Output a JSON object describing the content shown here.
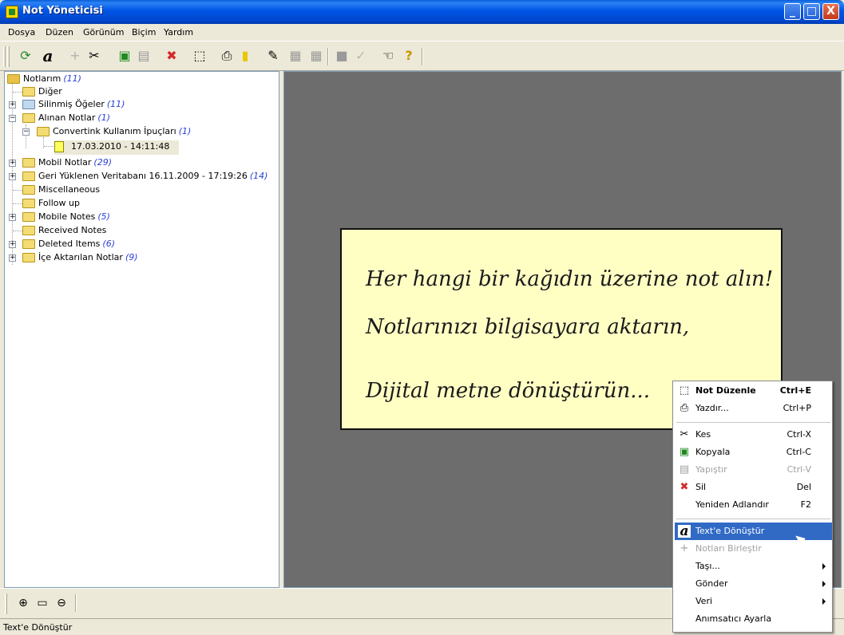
{
  "window": {
    "title": "Not Yöneticisi",
    "minimize": "_",
    "maximize": "□",
    "close": "X"
  },
  "menu": [
    "Dosya",
    "Düzen",
    "Görünüm",
    "Biçim",
    "Yardım"
  ],
  "toolbar": {
    "icons": [
      "sync-icon",
      "convert-text-icon",
      "merge-icon",
      "cut-icon",
      "copy-icon",
      "paste-icon",
      "delete-icon",
      "edit-note-icon",
      "print-icon",
      "new-note-icon",
      "rename-icon",
      "view-grid-icon",
      "view-grid2-icon",
      "color-icon",
      "check-icon",
      "hand-tool-icon",
      "help-icon"
    ],
    "glyphs": [
      "⟳",
      "a",
      "+",
      "✂",
      "▣",
      "▤",
      "✖",
      "⬚",
      "⎙",
      "▮",
      "✎",
      "▦",
      "▦",
      "■",
      "✓",
      "☜",
      "?"
    ]
  },
  "tree": {
    "items": [
      {
        "label": "Notlarım",
        "count": "(11)",
        "type": "root"
      },
      {
        "label": "Diğer",
        "count": ""
      },
      {
        "label": "Silinmiş Öğeler",
        "count": "(11)"
      },
      {
        "label": "Alınan Notlar",
        "count": "(1)"
      },
      {
        "label": "Convertink Kullanım İpuçları",
        "count": "(1)"
      },
      {
        "label": "17.03.2010 - 14:11:48",
        "count": "",
        "type": "note"
      },
      {
        "label": "Mobil Notlar",
        "count": "(29)"
      },
      {
        "label": "Geri Yüklenen Veritabanı 16.11.2009 - 17:19:26",
        "count": "(14)"
      },
      {
        "label": "Miscellaneous",
        "count": ""
      },
      {
        "label": "Follow up",
        "count": ""
      },
      {
        "label": "Mobile Notes",
        "count": "(5)"
      },
      {
        "label": "Received Notes",
        "count": ""
      },
      {
        "label": "Deleted Items",
        "count": "(6)"
      },
      {
        "label": "İçe Aktarılan Notlar",
        "count": "(9)"
      }
    ]
  },
  "note": {
    "lines": [
      "Her hangi bir kağıdın üzerine not alın!",
      "Notlarınızı bilgisayara aktarın,",
      "Dijital metne dönüştürün..."
    ]
  },
  "context_menu": {
    "items": [
      {
        "label": "Not Düzenle",
        "shortcut": "Ctrl+E",
        "icon": "⬚",
        "state": "bold"
      },
      {
        "label": "Yazdır...",
        "shortcut": "Ctrl+P",
        "icon": "⎙",
        "state": ""
      },
      {
        "label": "Kes",
        "shortcut": "Ctrl-X",
        "icon": "✂",
        "state": ""
      },
      {
        "label": "Kopyala",
        "shortcut": "Ctrl-C",
        "icon": "▣",
        "state": ""
      },
      {
        "label": "Yapıştır",
        "shortcut": "Ctrl-V",
        "icon": "▤",
        "state": "disabled"
      },
      {
        "label": "Sil",
        "shortcut": "Del",
        "icon": "✖",
        "state": ""
      },
      {
        "label": "Yeniden Adlandır",
        "shortcut": "F2",
        "icon": "",
        "state": ""
      },
      {
        "label": "Text'e Dönüştür",
        "shortcut": "",
        "icon": "a",
        "state": "highlight"
      },
      {
        "label": "Notları Birleştir",
        "shortcut": "",
        "icon": "+",
        "state": "disabled"
      },
      {
        "label": "Taşı...",
        "shortcut": "",
        "icon": "",
        "state": "submenu"
      },
      {
        "label": "Gönder",
        "shortcut": "",
        "icon": "",
        "state": "submenu"
      },
      {
        "label": "Veri",
        "shortcut": "",
        "icon": "",
        "state": "submenu"
      },
      {
        "label": "Anımsatıcı Ayarla",
        "shortcut": "",
        "icon": "",
        "state": ""
      }
    ]
  },
  "bottom_toolbar": {
    "icons": [
      "zoom-in-icon",
      "fit-icon",
      "zoom-out-icon"
    ],
    "glyphs": [
      "⊕",
      "▭",
      "⊖"
    ]
  },
  "status": {
    "text": "Text'e Dönüştür"
  }
}
